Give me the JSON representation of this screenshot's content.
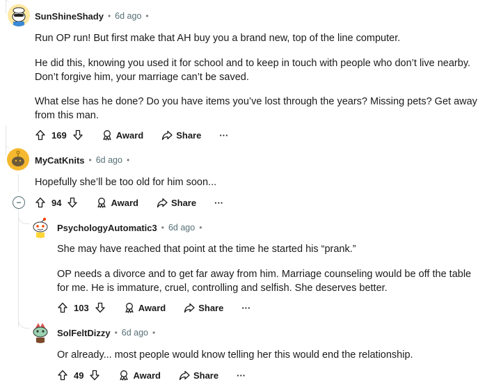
{
  "comments": [
    {
      "username": "SunShineShady",
      "time": "6d ago",
      "paragraphs": [
        "Run OP run! But first make that AH buy you a brand new, top of the line computer.",
        "He did this, knowing you used it for school and to keep in touch with people who don’t live nearby. Don’t forgive him, your marriage can’t be saved.",
        "What else has he done? Do you have items you’ve lost through the years? Missing pets? Get away from this man."
      ],
      "score": "169",
      "award_label": "Award",
      "share_label": "Share",
      "more_label": "···"
    },
    {
      "username": "MyCatKnits",
      "time": "6d ago",
      "paragraphs": [
        "Hopefully she’ll be too old for him soon..."
      ],
      "score": "94",
      "award_label": "Award",
      "share_label": "Share",
      "more_label": "···"
    },
    {
      "username": "PsychologyAutomatic3",
      "time": "6d ago",
      "paragraphs": [
        "She may have reached that point at the time he started his “prank.”",
        "OP needs a divorce and to get far away from him. Marriage counseling would be off the table for me. He is immature, cruel, controlling and selfish. She deserves better."
      ],
      "score": "103",
      "award_label": "Award",
      "share_label": "Share",
      "more_label": "···"
    },
    {
      "username": "SolFeltDizzy",
      "time": "6d ago",
      "paragraphs": [
        "Or already... most people would know telling her this would end the relationship."
      ],
      "score": "49",
      "award_label": "Award",
      "share_label": "Share",
      "more_label": "···"
    }
  ],
  "separator": "•",
  "colors": {
    "thread_line": "#e1e4e6",
    "meta": "#576f76",
    "text": "#1a1a1b"
  }
}
